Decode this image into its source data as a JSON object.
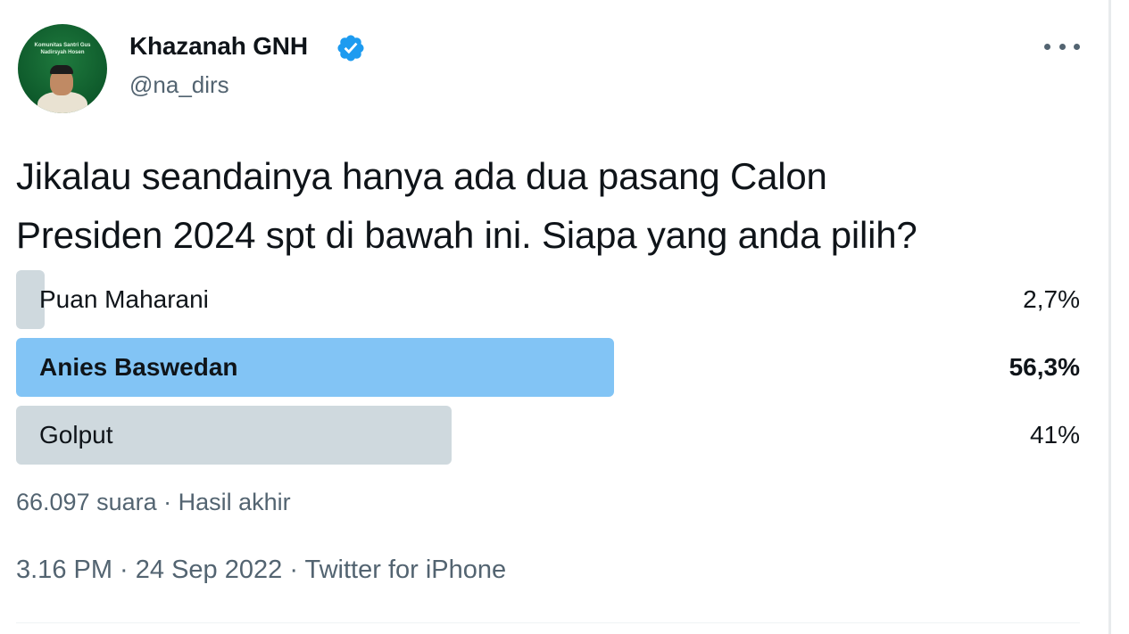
{
  "user": {
    "display_name": "Khazanah GNH",
    "handle": "@na_dirs",
    "verified": true,
    "avatar_text": "Komunitas Santri\nGus Nadirsyah Hosen"
  },
  "tweet": {
    "text": "Jikalau seandainya hanya ada dua pasang Calon\nPresiden 2024 spt di bawah ini. Siapa yang anda pilih?"
  },
  "poll": {
    "options": [
      {
        "label": "Puan Maharani",
        "percent_text": "2,7%",
        "percent": 2.7,
        "winner": false
      },
      {
        "label": "Anies Baswedan",
        "percent_text": "56,3%",
        "percent": 56.3,
        "winner": true
      },
      {
        "label": "Golput",
        "percent_text": "41%",
        "percent": 41,
        "winner": false
      }
    ],
    "votes": "66.097 suara",
    "separator": "·",
    "status": "Hasil akhir",
    "meta": "66.097 suara · Hasil akhir"
  },
  "timestamp": {
    "time": "3.16 PM",
    "date": "24 Sep 2022",
    "source": "Twitter for iPhone",
    "full": "3.16 PM · 24 Sep 2022 · Twitter for iPhone"
  },
  "colors": {
    "winner_bar": "#82c4f5",
    "loser_bar": "#cfd9de",
    "verified_badge": "#1d9bf0",
    "secondary_text": "#536471"
  },
  "icons": {
    "verified": "verified-badge-icon",
    "more": "more-options-icon"
  }
}
